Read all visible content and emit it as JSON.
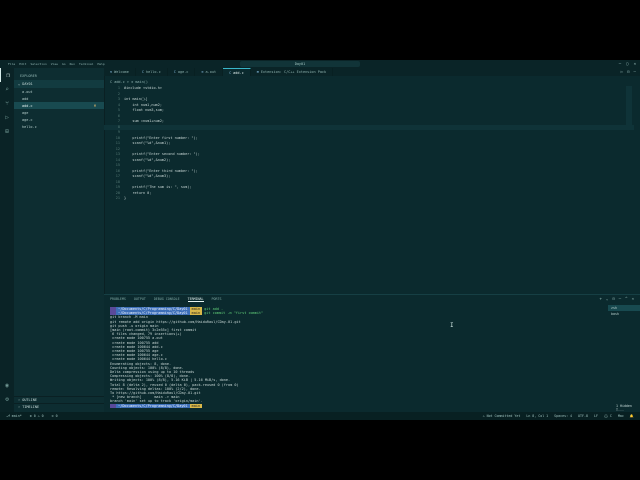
{
  "window": {
    "title": "Day01",
    "menu": [
      "File",
      "Edit",
      "Selection",
      "View",
      "Go",
      "Run",
      "Terminal",
      "Help"
    ],
    "controls": [
      "—",
      "▢",
      "✕"
    ]
  },
  "activity_icons": [
    "files-icon",
    "search-icon",
    "source-control-icon",
    "run-debug-icon",
    "extensions-icon"
  ],
  "sidebar": {
    "header": "EXPLORER",
    "folder": "DAY01",
    "files": [
      {
        "name": "a.out",
        "badge": ""
      },
      {
        "name": "add",
        "badge": ""
      },
      {
        "name": "add.c",
        "badge": "M"
      },
      {
        "name": "age",
        "badge": ""
      },
      {
        "name": "age.c",
        "badge": ""
      },
      {
        "name": "hello.c",
        "badge": ""
      }
    ],
    "outline": "OUTLINE",
    "timeline": "TIMELINE"
  },
  "tabs": [
    {
      "icon": "≋",
      "label": "Welcome"
    },
    {
      "icon": "C",
      "label": "hello.c"
    },
    {
      "icon": "C",
      "label": "age.c"
    },
    {
      "icon": "≡",
      "label": "a.out"
    },
    {
      "icon": "C",
      "label": "add.c"
    },
    {
      "icon": "⊞",
      "label": "Extension: C/C++ Extension Pack"
    }
  ],
  "breadcrumb": "C add.c > ⊙ main()",
  "code": [
    {
      "n": "1",
      "t": "#include <stdio.h>"
    },
    {
      "n": "2",
      "t": ""
    },
    {
      "n": "3",
      "t": "int main(){"
    },
    {
      "n": "4",
      "t": "    int num1,num2;"
    },
    {
      "n": "5",
      "t": "    float num3,sum;"
    },
    {
      "n": "6",
      "t": ""
    },
    {
      "n": "7",
      "t": "    sum =num1+num2;"
    },
    {
      "n": "8",
      "t": ""
    },
    {
      "n": "9",
      "t": ""
    },
    {
      "n": "10",
      "t": "    printf(\"Enter first number: \");"
    },
    {
      "n": "11",
      "t": "    scanf(\"%d\",&num1);"
    },
    {
      "n": "12",
      "t": ""
    },
    {
      "n": "13",
      "t": "    printf(\"Enter second number: \");"
    },
    {
      "n": "14",
      "t": "    scanf(\"%d\",&num2);"
    },
    {
      "n": "15",
      "t": ""
    },
    {
      "n": "16",
      "t": "    printf(\"Enter third number: \");"
    },
    {
      "n": "17",
      "t": "    scanf(\"%d\",&num3);"
    },
    {
      "n": "18",
      "t": ""
    },
    {
      "n": "19",
      "t": "    printf(\"The sum is: \", sum);"
    },
    {
      "n": "20",
      "t": "    return 0;"
    },
    {
      "n": "21",
      "t": "}"
    }
  ],
  "panel": {
    "tabs": [
      "PROBLEMS",
      "OUTPUT",
      "DEBUG CONSOLE",
      "TERMINAL",
      "PORTS"
    ],
    "actions": [
      "+",
      "⌄",
      "⊟",
      "⋯",
      "^",
      "✕"
    ],
    "terminals": [
      "zsh",
      "bash"
    ]
  },
  "terminal": [
    {
      "seg": [
        {
          "c": "a",
          "t": "~/Documents/C/Programming/C/Day01"
        },
        {
          "c": "b",
          "t": "main"
        }
      ],
      "cmd": "git add ."
    },
    {
      "seg": [
        {
          "c": "a",
          "t": "~/Documents/C/Programming/C/Day01"
        },
        {
          "c": "b",
          "t": "main"
        }
      ],
      "cmd": "git commit -m \"first commit\""
    },
    {
      "text": "git branch -M main"
    },
    {
      "text": "git remote add origin https://github.com/HaiduRaul/CDay-01.git"
    },
    {
      "text": "git push -u origin main"
    },
    {
      "text": "[main (root-commit) 3c2e55c] first commit"
    },
    {
      "text": " 6 files changed, 79 insertions(+)"
    },
    {
      "text": " create mode 100755 a.out"
    },
    {
      "text": " create mode 100755 add"
    },
    {
      "text": " create mode 100644 add.c"
    },
    {
      "text": " create mode 100755 age"
    },
    {
      "text": " create mode 100644 age.c"
    },
    {
      "text": " create mode 100644 hello.c"
    },
    {
      "text": "Enumerating objects: 8, done."
    },
    {
      "text": "Counting objects: 100% (8/8), done."
    },
    {
      "text": "Delta compression using up to 10 threads"
    },
    {
      "text": "Compressing objects: 100% (8/8), done."
    },
    {
      "text": "Writing objects: 100% (8/8), 5.16 KiB | 5.16 MiB/s, done."
    },
    {
      "text": "Total 8 (delta 2), reused 0 (delta 0), pack-reused 0 (from 0)"
    },
    {
      "text": "remote: Resolving deltas: 100% (2/2), done."
    },
    {
      "text": "To https://github.com/HaiduRaul/CDay-01.git"
    },
    {
      "text": " * [new branch]      main -> main"
    },
    {
      "text": "branch 'main' set up to track 'origin/main'."
    },
    {
      "seg": [
        {
          "c": "a",
          "t": "~/Documents/C/Programming/C/Day01"
        },
        {
          "c": "b",
          "t": "main"
        }
      ],
      "cmd": ""
    }
  ],
  "status": {
    "left": [
      "⎇ main*",
      "⊗ 0 ⚠ 0",
      "⊙ 0"
    ],
    "right": [
      "⚠ Not Committed Yet",
      "Ln 8, Col 1",
      "Spaces: 4",
      "UTF-8",
      "LF",
      "{} C",
      "Mac",
      "🔔"
    ]
  },
  "toast": "1 Hidden T..."
}
